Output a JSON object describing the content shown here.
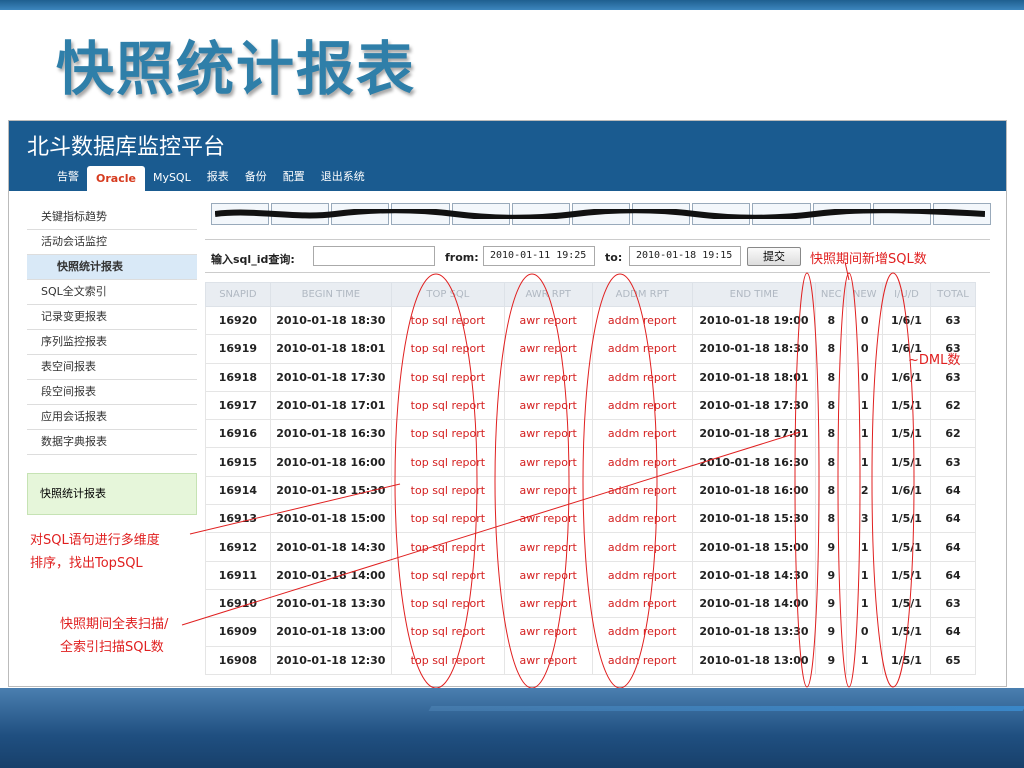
{
  "slide_title": "快照统计报表",
  "app": {
    "title": "北斗数据库监控平台",
    "nav": [
      "告警",
      "Oracle",
      "MySQL",
      "报表",
      "备份",
      "配置",
      "退出系统"
    ],
    "active_nav": "Oracle"
  },
  "sidebar": {
    "items": [
      "关键指标趋势",
      "活动会话监控",
      "快照统计报表",
      "SQL全文索引",
      "记录变更报表",
      "序列监控报表",
      "表空间报表",
      "段空间报表",
      "应用会话报表",
      "数据字典报表"
    ],
    "active_item": "快照统计报表",
    "box_label": "快照统计报表"
  },
  "query": {
    "sql_id_label": "输入sql_id查询:",
    "sql_id_value": "",
    "from_label": "from:",
    "from_value": "2010-01-11 19:25",
    "to_label": "to:",
    "to_value": "2010-01-18 19:15",
    "submit_label": "提交"
  },
  "table": {
    "headers": [
      "SNAPID",
      "BEGIN TIME",
      "TOP SQL",
      "AWR RPT",
      "ADDM RPT",
      "END TIME",
      "NEC",
      "NEW",
      "I/U/D",
      "TOTAL"
    ],
    "rows": [
      [
        "16920",
        "2010-01-18 18:30",
        "top sql report",
        "awr report",
        "addm report",
        "2010-01-18 19:00",
        "8",
        "0",
        "1/6/1",
        "63"
      ],
      [
        "16919",
        "2010-01-18 18:01",
        "top sql report",
        "awr report",
        "addm report",
        "2010-01-18 18:30",
        "8",
        "0",
        "1/6/1",
        "63"
      ],
      [
        "16918",
        "2010-01-18 17:30",
        "top sql report",
        "awr report",
        "addm report",
        "2010-01-18 18:01",
        "8",
        "0",
        "1/6/1",
        "63"
      ],
      [
        "16917",
        "2010-01-18 17:01",
        "top sql report",
        "awr report",
        "addm report",
        "2010-01-18 17:30",
        "8",
        "1",
        "1/5/1",
        "62"
      ],
      [
        "16916",
        "2010-01-18 16:30",
        "top sql report",
        "awr report",
        "addm report",
        "2010-01-18 17:01",
        "8",
        "1",
        "1/5/1",
        "62"
      ],
      [
        "16915",
        "2010-01-18 16:00",
        "top sql report",
        "awr report",
        "addm report",
        "2010-01-18 16:30",
        "8",
        "1",
        "1/5/1",
        "63"
      ],
      [
        "16914",
        "2010-01-18 15:30",
        "top sql report",
        "awr report",
        "addm report",
        "2010-01-18 16:00",
        "8",
        "2",
        "1/6/1",
        "64"
      ],
      [
        "16913",
        "2010-01-18 15:00",
        "top sql report",
        "awr report",
        "addm report",
        "2010-01-18 15:30",
        "8",
        "3",
        "1/5/1",
        "64"
      ],
      [
        "16912",
        "2010-01-18 14:30",
        "top sql report",
        "awr report",
        "addm report",
        "2010-01-18 15:00",
        "9",
        "1",
        "1/5/1",
        "64"
      ],
      [
        "16911",
        "2010-01-18 14:00",
        "top sql report",
        "awr report",
        "addm report",
        "2010-01-18 14:30",
        "9",
        "1",
        "1/5/1",
        "64"
      ],
      [
        "16910",
        "2010-01-18 13:30",
        "top sql report",
        "awr report",
        "addm report",
        "2010-01-18 14:00",
        "9",
        "1",
        "1/5/1",
        "63"
      ],
      [
        "16909",
        "2010-01-18 13:00",
        "top sql report",
        "awr report",
        "addm report",
        "2010-01-18 13:30",
        "9",
        "0",
        "1/5/1",
        "64"
      ],
      [
        "16908",
        "2010-01-18 12:30",
        "top sql report",
        "awr report",
        "addm report",
        "2010-01-18 13:00",
        "9",
        "1",
        "1/5/1",
        "65"
      ]
    ]
  },
  "annotations": {
    "new_sql": "快照期间新增SQL数",
    "dml": "~DML数",
    "topsql_line1": "对SQL语句进行多维度",
    "topsql_line2": "排序，找出TopSQL",
    "scan_line1": "快照期间全表扫描/",
    "scan_line2": "全索引扫描SQL数"
  },
  "colors": {
    "header_bg": "#1a5b90",
    "title": "#2f7fa9",
    "annotation": "#e02020",
    "link": "#d42020"
  }
}
